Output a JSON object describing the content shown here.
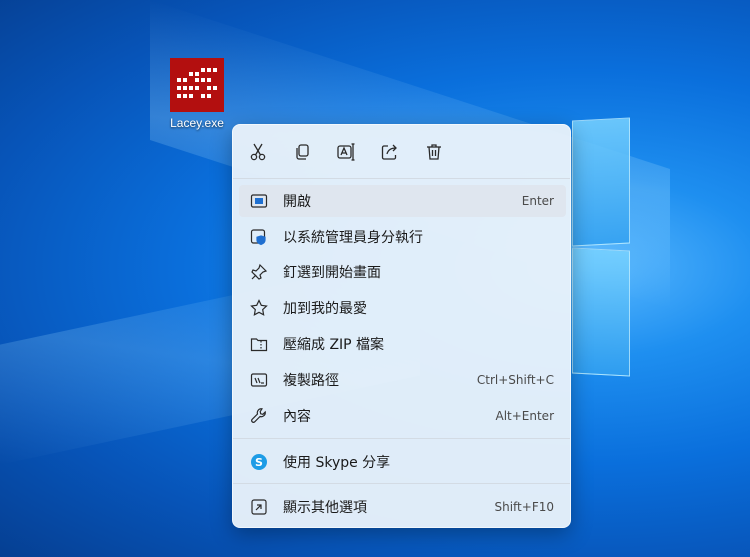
{
  "desktop": {
    "icon_label": "Lacey.exe"
  },
  "context_menu": {
    "toolbar": [
      {
        "name": "cut-icon"
      },
      {
        "name": "copy-icon"
      },
      {
        "name": "rename-icon"
      },
      {
        "name": "share-icon"
      },
      {
        "name": "delete-icon"
      }
    ],
    "items": [
      {
        "label": "開啟",
        "shortcut": "Enter",
        "icon": "open-icon"
      },
      {
        "label": "以系統管理員身分執行",
        "shortcut": "",
        "icon": "admin-shield-icon"
      },
      {
        "label": "釘選到開始畫面",
        "shortcut": "",
        "icon": "pin-icon"
      },
      {
        "label": "加到我的最愛",
        "shortcut": "",
        "icon": "star-icon"
      },
      {
        "label": "壓縮成 ZIP 檔案",
        "shortcut": "",
        "icon": "zip-folder-icon"
      },
      {
        "label": "複製路徑",
        "shortcut": "Ctrl+Shift+C",
        "icon": "copy-path-icon"
      },
      {
        "label": "內容",
        "shortcut": "Alt+Enter",
        "icon": "wrench-icon"
      },
      {
        "label": "使用 Skype 分享",
        "shortcut": "",
        "icon": "skype-icon"
      },
      {
        "label": "顯示其他選項",
        "shortcut": "Shift+F10",
        "icon": "more-options-icon"
      }
    ]
  }
}
